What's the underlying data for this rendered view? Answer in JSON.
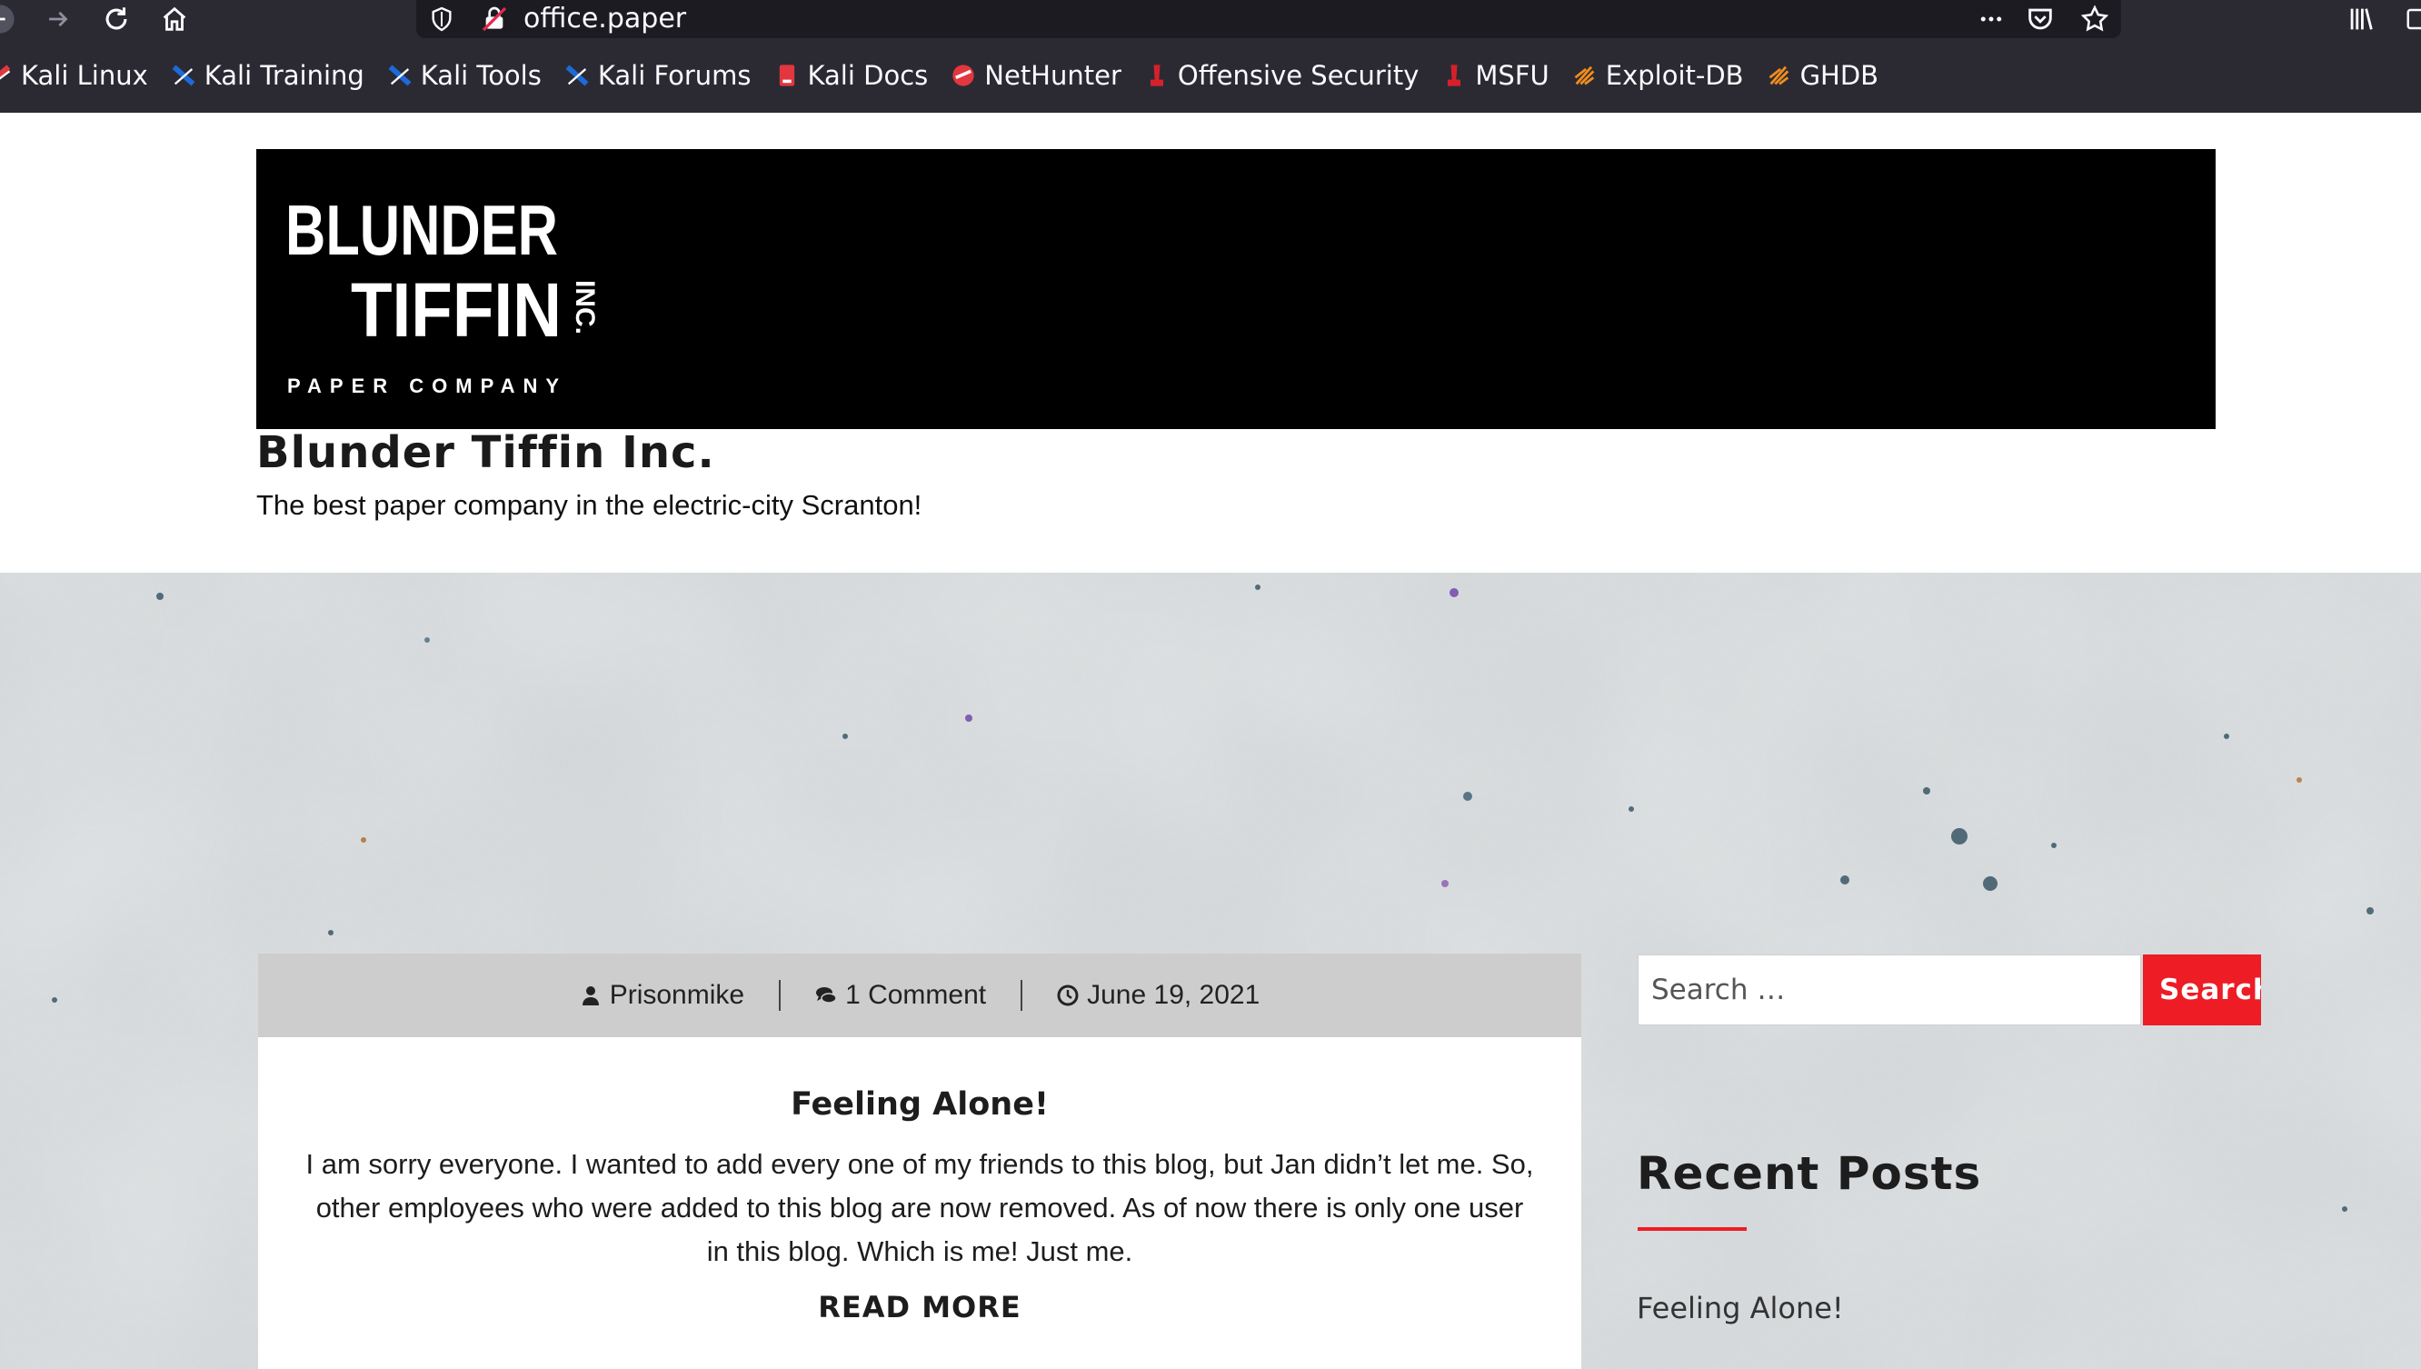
{
  "browser": {
    "url": "office.paper",
    "bookmarks": [
      {
        "label": "Kali Linux",
        "icon": "kali-dragon-icon"
      },
      {
        "label": "Kali Training",
        "icon": "kali-dragon-icon"
      },
      {
        "label": "Kali Tools",
        "icon": "kali-dragon-icon"
      },
      {
        "label": "Kali Forums",
        "icon": "kali-dragon-icon"
      },
      {
        "label": "Kali Docs",
        "icon": "kali-docs-icon"
      },
      {
        "label": "NetHunter",
        "icon": "nethunter-icon"
      },
      {
        "label": "Offensive Security",
        "icon": "offsec-icon"
      },
      {
        "label": "MSFU",
        "icon": "offsec-icon"
      },
      {
        "label": "Exploit-DB",
        "icon": "exploit-db-icon"
      },
      {
        "label": "GHDB",
        "icon": "exploit-db-icon"
      }
    ]
  },
  "header": {
    "logo": {
      "line1": "BLUNDER",
      "line2": "TIFFIN",
      "inc": "INC.",
      "line3": "PAPER COMPANY"
    },
    "site_title": "Blunder Tiffin Inc.",
    "tagline": "The best paper company in the electric-city Scranton!"
  },
  "post": {
    "author": "Prisonmike",
    "comments": "1 Comment",
    "date": "June 19, 2021",
    "title": "Feeling Alone!",
    "excerpt": "I am sorry everyone. I wanted to add every one of my friends to this blog, but Jan didn’t let me. So, other employees who were added to this blog are now removed. As of now there is only one user in this blog. Which is me! Just me.",
    "read_more": "READ MORE"
  },
  "sidebar": {
    "search_placeholder": "Search …",
    "search_button": "Search",
    "recent_title": "Recent Posts",
    "recent_posts": [
      "Feeling Alone!"
    ]
  },
  "colors": {
    "accent": "#ee1c25",
    "chrome": "#2b2a33",
    "urlbar": "#1c1b22"
  }
}
